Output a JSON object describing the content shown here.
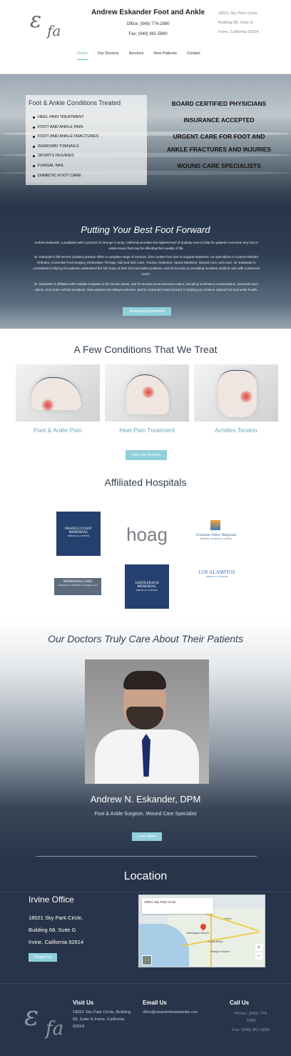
{
  "header": {
    "logo_text": "εfa",
    "title": "Andrew Eskander Foot and Ankle",
    "office_phone": "Office: (949) 774-2890",
    "fax": "Fax: (949) 861-5890",
    "address": [
      "18021 Sky Park Circle,",
      "Building 68, Suite G",
      "Irvine, California 92614"
    ],
    "nav": [
      "Home",
      "Our Doctors",
      "Services",
      "New Patients",
      "Contact"
    ],
    "active_nav": "Home"
  },
  "hero": {
    "box_title": "Foot & Ankle Conditions Treated",
    "conditions": [
      "HEEL PAIN TREATMENT",
      "FOOT AND ANKLE PAIN",
      "FOOT AND ANKLE FRACTURES",
      "INGROWN TOENAILS",
      "SPORTS INJURIES",
      "FUNGAL NAIL",
      "DIABETIC FOOT CARE"
    ],
    "claims": [
      "BOARD CERTIFIED PHYSICIANS",
      "INSURANCE ACCEPTED",
      "URGENT CARE FOR FOOT AND",
      "ANKLE FRACTURES AND INJURIES",
      "WOUND CARE SPECIALISTS"
    ]
  },
  "intro": {
    "heading": "Putting Your Best Foot Forward",
    "p1": "Andrew Eskander, a podiatrist with a practice in Orange County, California provides the highest level of podiatry care to help his patients overcome any foot or ankle issues that may be affecting their quality of life.",
    "p2": "Dr. Eskander's full-service podiatry practice offers a complete range of services, from routine foot care to surgical treatment. He specializes in Custom-Molded Orthotics, Corrective Foot Surgery, Restorative Therapy, Nail and Skin Care, Trauma Treatment, Sports Medicine, Wound Care, and more. Dr. Eskander is committed to helping his patients understand the full scope of their foot and ankle problems, and he focuses on providing excellent medical care with a personal touch.",
    "p3": "Dr. Eskander is affiliated with multiple hospitals in his service areas, and he accepts most insurance plans, including workman's compensation, personal injury claims, and motor vehicle accidents. New patients are always welcome, and Dr. Eskander looks forward to helping you achieve optimal foot and ankle health.",
    "button": "Schedule Appointment"
  },
  "conditions": {
    "heading": "A Few Conditions That We Treat",
    "items": [
      "Foot & Ankle Pain",
      "Heel Pain Treatment",
      "Achilles Tendon"
    ],
    "button": "View Our Services"
  },
  "hospitals": {
    "heading": "Affiliated Hospitals",
    "logos": [
      {
        "name": "ORANGE COAST MEMORIAL",
        "sub": "MEDICAL CENTER"
      },
      {
        "name": "hoag"
      },
      {
        "name": "Fountain Valley Regional",
        "sub": "HOSPITAL & MEDICAL CENTER"
      },
      {
        "name": "MEMORIALCARE",
        "sub": "SURGICAL CENTER at Orange Coast"
      },
      {
        "name": "SADDLEBACK MEMORIAL",
        "sub": "MEDICAL CENTER"
      },
      {
        "name": "LOS ALAMITOS",
        "sub": "MEDICAL CENTER"
      }
    ]
  },
  "doctor": {
    "heading": "Our Doctors Truly Care About Their Patients",
    "name": "Andrew N. Eskander, DPM",
    "role": "Foot & Ankle Surgeon, Wound Care Specialist",
    "button": "Learn More"
  },
  "location": {
    "heading": "Location",
    "office": "Irvine Office",
    "address": [
      "18021 Sky Park Circle,",
      "Building 68, Suite G",
      "Irvine, California 92614"
    ],
    "button": "Contact Us",
    "map_labels": [
      "18021 Sky Park Circle",
      "Huntington Beach",
      "Irvine",
      "Costa Mesa",
      "Newport Beach"
    ]
  },
  "footer": {
    "visit_heading": "Visit Us",
    "visit_text": [
      "18021 Sky Park Circle, Building",
      "68, Suite G Irvine, California",
      "92614"
    ],
    "email_heading": "Email Us",
    "email": "office@eskanderfootandankle.com",
    "call_heading": "Call Us",
    "phone_lines": [
      "Phone: (949) 774-",
      "2890"
    ],
    "fax": "Fax: (949) 861-5890"
  }
}
